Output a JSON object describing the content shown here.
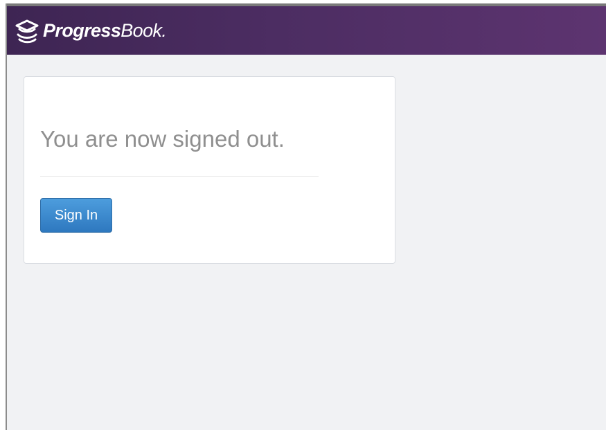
{
  "brand": {
    "name_strong": "Progress",
    "name_light": "Book",
    "trademark": ".",
    "logo_icon": "graduation-cap-logo-icon"
  },
  "signout": {
    "message": "You are now signed out.",
    "sign_in_label": "Sign In"
  },
  "colors": {
    "header_dark": "#3e2553",
    "header_light": "#5d3470",
    "page_background": "#f1f2f4",
    "button_blue": "#2e78bf",
    "message_gray": "#8f8f8f"
  }
}
